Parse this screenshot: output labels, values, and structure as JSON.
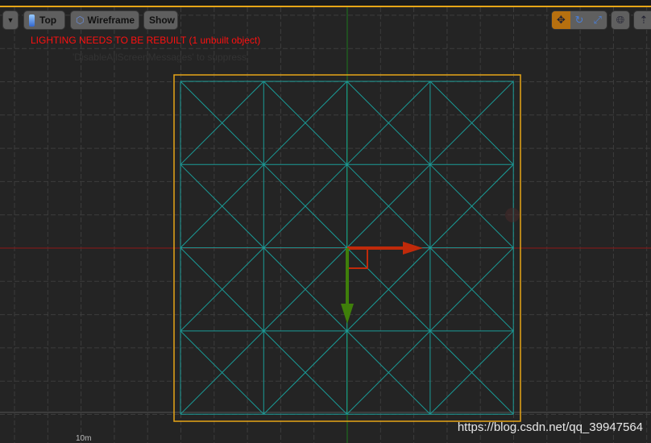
{
  "toolbar": {
    "view_label": "Top",
    "mode_label": "Wireframe",
    "show_label": "Show"
  },
  "messages": {
    "lighting": "LIGHTING NEEDS TO BE REBUILT (1 unbuilt object)",
    "suppress": "'DisableAllScreenMessages' to suppress"
  },
  "scale_label": "10m",
  "watermark": "https://blog.csdn.net/qq_39947564",
  "colors": {
    "selection": "#e7a516",
    "wire": "#1a9c98",
    "x_axis": "#c02a0a",
    "y_axis": "#3f7f0a",
    "active_tool": "#b7700f"
  },
  "transform_tools": [
    "translate-icon",
    "rotate-icon",
    "scale-icon"
  ],
  "active_tool": "translate-icon"
}
